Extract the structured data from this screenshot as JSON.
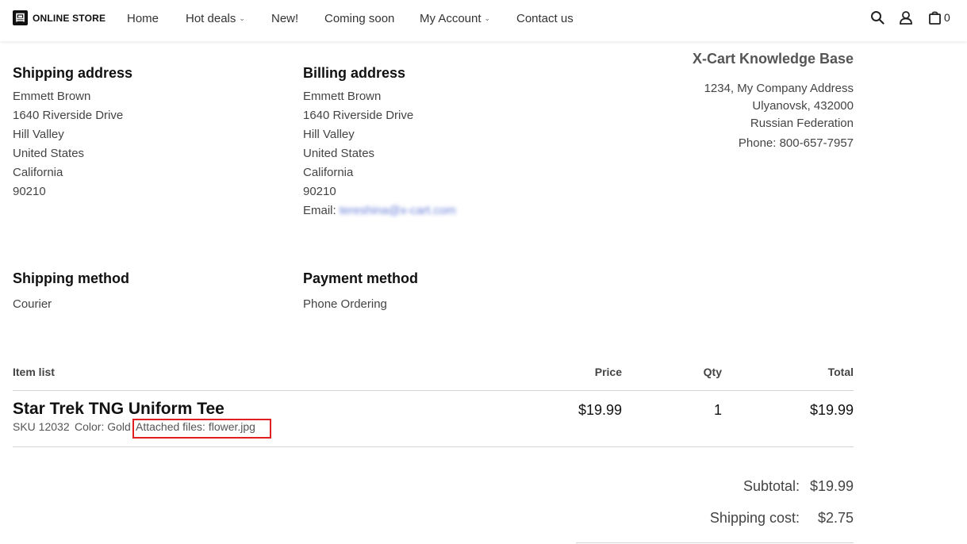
{
  "header": {
    "logo_text": "ONLINE STORE",
    "nav": {
      "home": "Home",
      "hot_deals": "Hot deals",
      "new": "New!",
      "coming_soon": "Coming soon",
      "my_account": "My Account",
      "contact": "Contact us"
    },
    "icons": [
      "search-icon",
      "user-icon",
      "bag-icon"
    ],
    "cart_count": "0"
  },
  "shipping_address": {
    "title": "Shipping address",
    "lines": [
      "Emmett  Brown",
      "1640 Riverside Drive",
      "Hill Valley",
      "United States",
      "California",
      "90210"
    ]
  },
  "billing_address": {
    "title": "Billing address",
    "lines": [
      "Emmett  Brown",
      "1640 Riverside Drive",
      "Hill Valley",
      "United States",
      "California",
      "90210"
    ],
    "email_label": "Email:",
    "email_value": "tereshina@x-cart.com"
  },
  "company": {
    "name": "X-Cart Knowledge Base",
    "address_lines": [
      "1234, My Company Address",
      "Ulyanovsk, 432000",
      "Russian Federation"
    ],
    "phone": "Phone: 800-657-7957"
  },
  "shipping_method": {
    "title": "Shipping method",
    "value": "Courier"
  },
  "payment_method": {
    "title": "Payment method",
    "value": "Phone Ordering"
  },
  "items_table": {
    "headers": {
      "item_list": "Item list",
      "price": "Price",
      "qty": "Qty",
      "total": "Total"
    },
    "rows": [
      {
        "name": "Star Trek TNG Uniform Tee",
        "sku": "SKU 12032",
        "color": "Color: Gold",
        "attached": "Attached files: flower.jpg",
        "price": "$19.99",
        "qty": "1",
        "total": "$19.99"
      }
    ]
  },
  "totals": {
    "subtotal_label": "Subtotal:",
    "subtotal_value": "$19.99",
    "shipping_label": "Shipping cost:",
    "shipping_value": "$2.75"
  },
  "colors": {
    "highlight_box": "#e02020",
    "email_blur": "#6a7fd8"
  }
}
